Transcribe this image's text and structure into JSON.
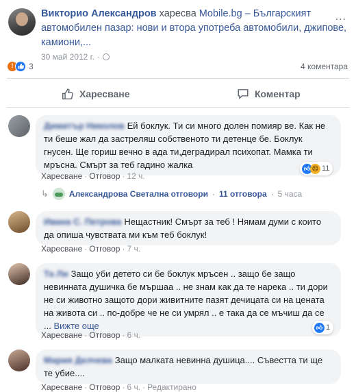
{
  "post": {
    "author": "Викторио Александров",
    "action": "харесва",
    "page": "Mobile.bg – Българският автомобилен пазар: нови и втора употреба автомобили, джипове, камиони,...",
    "date": "30 май 2012 г.",
    "dot": "·",
    "menu": "...",
    "reaction_count": "3",
    "comments_count": "4 коментара",
    "like_label": "Харесване",
    "comment_label": "Коментар"
  },
  "comments": [
    {
      "name": "Димитър Николов",
      "text": "Ей боклук. Ти си много долен помияр ве. Как не ти беше жал да застреляш собственото ти детенце бе. Боклук гнусен. Ще гориш вечно в ада ти,деградирал психопат. Мамка ти мръсна. Смърт за теб гадино жалка",
      "like": "Харесване",
      "reply": "Отговор",
      "time": "12 ч.",
      "reactions": "11",
      "replies": {
        "text": "Александрова Светална отговори",
        "count": "11 отговора",
        "time": "5 часа"
      }
    },
    {
      "name": "Ивана С. Петрова",
      "text": "Нещастник! Смърт за теб ! Нямам думи с които да опиша чувствата ми към теб боклук!",
      "like": "Харесване",
      "reply": "Отговор",
      "time": "7 ч."
    },
    {
      "name": "Та Ли",
      "text": "Защо уби детето си бе боклук мръсен .. защо бе защо невинната душичка бе мършаа .. не знам как да те нарека .. ти дори не си животно защото дори живитните пазят дечицата си на цената на живота си .. по-добре че не си умрял .. е така да се мъчиш да се ...",
      "see_more": "Вижте още",
      "like": "Харесване",
      "reply": "Отговор",
      "time": "6 ч.",
      "reactions": "1"
    },
    {
      "name": "Мария Делчева",
      "text": "Защо малката невинна душица.... Съвестта ти ще те убие....",
      "like": "Харесване",
      "reply": "Отговор",
      "time": "6 ч.",
      "edited": "Редактирано"
    }
  ],
  "colors": {
    "link": "#365899",
    "bubble": "#f2f3f5",
    "like_blue": "#2078f4",
    "angry_orange": "#e9710f"
  },
  "icons": {
    "like": "thumbs-up-icon",
    "comment": "speech-bubble-icon",
    "privacy": "globe-icon"
  }
}
